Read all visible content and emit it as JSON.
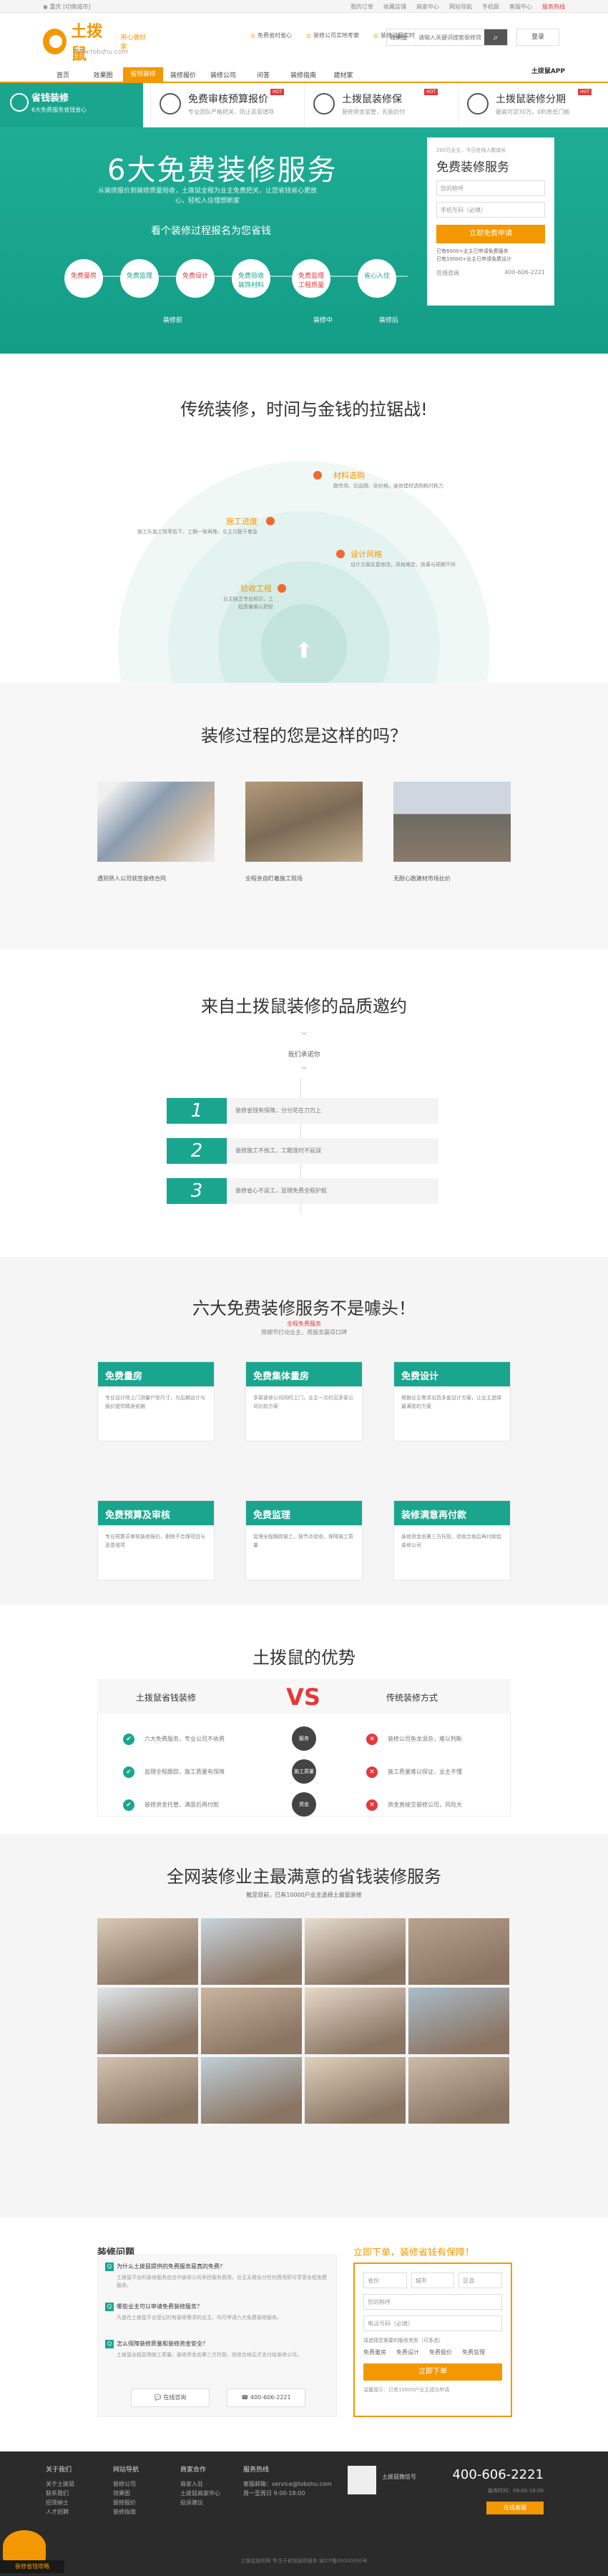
{
  "topbar": {
    "city_icon": "location-icon",
    "city": "重庆",
    "switch": "[切换城市]",
    "links": [
      "我的订单",
      "收藏店铺",
      "商家中心",
      "网站导航",
      "手机版",
      "客服中心",
      "服务热线"
    ]
  },
  "header": {
    "brand": "土拨鼠",
    "brand_sub": "www.tobshu.com",
    "slogan": "用心做好家",
    "promises": [
      "免费省时省心",
      "装修公司实地考察",
      "装修过程实时监管"
    ],
    "search_scope": "效果图",
    "search_placeholder": "请输入关键词搜索装修效果",
    "search_icon": "search-icon",
    "login": "登录"
  },
  "nav": {
    "items": [
      "首页",
      "效果图",
      "省钱装修",
      "装修报价",
      "装修公司",
      "问答",
      "装修指南",
      "建材家"
    ],
    "active_index": 2,
    "app": "土拨鼠APP"
  },
  "tabs": [
    {
      "title": "省钱装修",
      "sub": "6大免费服务省钱省心",
      "icon": "savings-icon"
    },
    {
      "title": "免费审核预算报价",
      "sub": "专业团队严格把关，防止恶意增项",
      "icon": "audit-icon",
      "hot": "HOT"
    },
    {
      "title": "土拨鼠装修保",
      "sub": "装修资金监管，先装后付",
      "icon": "shield-icon",
      "hot": "HOT"
    },
    {
      "title": "土拨鼠装修分期",
      "sub": "最高可贷30万，0利息低门槛",
      "icon": "installment-icon",
      "hot": "HOT"
    }
  ],
  "hero": {
    "title": "6大免费装修服务",
    "desc": "从装修报价到装修质量验收，土拨鼠全程为业主免费把关，让您省钱省心更放心，轻松入住理想新家",
    "flow_title": "看个装修过程报名为您省钱",
    "steps": [
      "免费量房",
      "免费监理",
      "免费设计",
      "免费验收\n装饰材料",
      "免费监理\n工程质量",
      "省心入住"
    ],
    "phases": [
      "装修前",
      "装修中",
      "装修后"
    ]
  },
  "form": {
    "small": "200万业主，今日在线人数增长",
    "title": "免费装修服务",
    "name_ph": "您的称呼",
    "phone_ph": "手机号码（必填）",
    "cta": "立即免费申请",
    "notes": [
      "已有6000+业主已申请免费服务",
      "已有10000+业主已申请免费设计"
    ],
    "consult": "在线咨询",
    "phone": "400-606-2221"
  },
  "sec2": {
    "title": "传统装修，时间与金钱的拉锯战!",
    "points": [
      {
        "title": "材料选购",
        "desc": "跑市场、比品牌、砍价格，装修建材选购耗时耗力"
      },
      {
        "title": "施工进度",
        "desc": "施工队施工效率低下，工期一拖再拖，业主只能干着急"
      },
      {
        "title": "设计风格",
        "desc": "设计方案反复修改，风格难定，效果与预期不符"
      },
      {
        "title": "验收工程",
        "desc": "业主缺乏专业知识，工程质量难以把控"
      }
    ]
  },
  "sec3": {
    "title": "装修过程的您是这样的吗？",
    "items": [
      "遇到熟人公司就签装修合同",
      "全程亲自盯着施工现场",
      "无耐心跑建材市场比价"
    ]
  },
  "sec4": {
    "title": "来自土拨鼠装修的品质邀约",
    "sub": "我们承诺你",
    "rows": [
      {
        "num": "1",
        "text": "装修省钱有保障，分分花在刀刃上"
      },
      {
        "num": "2",
        "text": "装修施工不拖工，工期准时不延误"
      },
      {
        "num": "3",
        "text": "装修省心不返工，监理免费全程护航"
      }
    ]
  },
  "sec5": {
    "title": "六大免费装修服务不是噱头！",
    "sub_top": "全程免费服务",
    "sub": "用细节打动业主，用服务赢得口碑",
    "items": [
      {
        "title": "免费量房",
        "desc": "专业设计师上门测量户型尺寸，为后期设计与报价提供精准依据"
      },
      {
        "title": "免费集体量房",
        "desc": "多家装修公司同时上门，业主一次约见多家公司比较方案"
      },
      {
        "title": "免费设计",
        "desc": "根据业主需求出具多套设计方案，让业主选择最满意的方案"
      },
      {
        "title": "免费预算及审核",
        "desc": "专业预算员审核装修报价，剔除不合理项目与恶意增项"
      },
      {
        "title": "免费监理",
        "desc": "监理全程跟踪施工，按节点验收，保障施工质量"
      },
      {
        "title": "装修满意再付款",
        "desc": "装修资金由第三方托管，验收合格后再付款给装修公司"
      }
    ]
  },
  "sec6": {
    "title": "土拨鼠的优势",
    "left_head": "土拨鼠省钱装修",
    "vs": "VS",
    "right_head": "传统装修方式",
    "rows": [
      {
        "left": "六大免费服务，专业公司不收费",
        "mid": "服务",
        "right": "装修公司鱼龙混杂，难以判断"
      },
      {
        "left": "监理全程跟踪，施工质量有保障",
        "mid": "施工质量",
        "right": "施工质量难以保证，业主不懂"
      },
      {
        "left": "装修资金托管，满意后再付款",
        "mid": "资金",
        "right": "资金直接交装修公司，风险大"
      }
    ]
  },
  "sec7": {
    "title": "全网装修业主最满意的省钱装修服务",
    "sub": "截至目前，已有10000户业主选择土拨鼠装修"
  },
  "sec8": {
    "title": "装修问题",
    "faqs": [
      {
        "q": "为什么土拨鼠提供的免费服务是真的免费？",
        "a": "土拨鼠平台的装修服务由合作装修公司承担服务费用，业主无需支付任何费用即可享受全程免费服务。"
      },
      {
        "q": "哪些业主可以申请免费装修服务？",
        "a": "凡是在土拨鼠平台登记的有装修需求的业主，均可申请六大免费装修服务。"
      },
      {
        "q": "怎么保障装修质量和装修资金安全？",
        "a": "土拨鼠全程监理施工质量，装修资金由第三方托管，验收合格后才支付给装修公司。"
      }
    ],
    "consult": "在线咨询",
    "phone": "400-606-2221",
    "order_title": "立即下单，装修省钱有保障！",
    "province": "省份",
    "city": "城市",
    "district": "区县",
    "name_ph": "您的称呼",
    "phone_ph": "电话号码（必填）",
    "type_label": "请选择您需要的服务类型（可多选）",
    "types": [
      "免费量房",
      "免费设计",
      "免费报价",
      "免费监理"
    ],
    "cta": "立即下单",
    "note": "温馨提示：已有10000户业主成功申请"
  },
  "footer": {
    "cols": [
      {
        "title": "关于我们",
        "items": [
          "关于土拨鼠",
          "联系我们",
          "招贤纳士",
          "人才招聘"
        ]
      },
      {
        "title": "网站导航",
        "items": [
          "装修公司",
          "效果图",
          "装修报价",
          "装修指南"
        ]
      },
      {
        "title": "商家合作",
        "items": [
          "商家入驻",
          "土拨鼠商家中心",
          "投诉建议"
        ]
      },
      {
        "title": "服务热线",
        "items": [
          "客服邮箱：service@tobshu.com",
          "周一至周日 9:00-18:00"
        ]
      }
    ],
    "qr_caption": "土拨鼠微信号",
    "phone": "400-606-2221",
    "hours": "服务时间：09:00-18:00",
    "online": "在线客服",
    "copyright": "土拨鼠装修网  专注于省钱装修服务  渝ICP备00000000号"
  },
  "float_badge": {
    "text": "装修省钱攻略",
    "icon": "gift-icon"
  }
}
